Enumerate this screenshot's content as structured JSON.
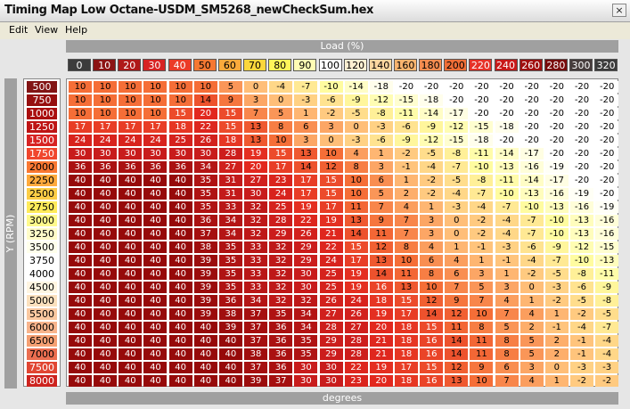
{
  "window": {
    "title": "Timing Map Low Octane-USDM_SM5268_newCheckSum.hex",
    "close_label": "×"
  },
  "menu": [
    "Edit",
    "View",
    "Help"
  ],
  "load_axis": {
    "title": "Load (%)",
    "values": [
      "0",
      "10",
      "20",
      "30",
      "40",
      "50",
      "60",
      "70",
      "80",
      "90",
      "100",
      "120",
      "140",
      "160",
      "180",
      "200",
      "220",
      "240",
      "260",
      "280",
      "300",
      "320"
    ]
  },
  "rpm_axis": {
    "title": "Y (RPM)",
    "values": [
      "500",
      "750",
      "1000",
      "1250",
      "1500",
      "1750",
      "2000",
      "2250",
      "2500",
      "2750",
      "3000",
      "3250",
      "3500",
      "3750",
      "4000",
      "4500",
      "5000",
      "5500",
      "6000",
      "6500",
      "7000",
      "7500",
      "8000"
    ]
  },
  "unit_label": "degrees",
  "table": [
    [
      10,
      10,
      10,
      10,
      10,
      10,
      5,
      0,
      -4,
      -7,
      -10,
      -14,
      -18,
      -20,
      -20,
      -20,
      -20,
      -20,
      -20,
      -20,
      -20,
      -20
    ],
    [
      10,
      10,
      10,
      10,
      10,
      14,
      9,
      3,
      0,
      -3,
      -6,
      -9,
      -12,
      -15,
      -18,
      -20,
      -20,
      -20,
      -20,
      -20,
      -20,
      -20
    ],
    [
      10,
      10,
      10,
      10,
      15,
      20,
      15,
      7,
      5,
      1,
      -2,
      -5,
      -8,
      -11,
      -14,
      -17,
      -20,
      -20,
      -20,
      -20,
      -20,
      -20
    ],
    [
      17,
      17,
      17,
      17,
      18,
      22,
      15,
      13,
      8,
      6,
      3,
      0,
      -3,
      -6,
      -9,
      -12,
      -15,
      -18,
      -20,
      -20,
      -20,
      -20
    ],
    [
      24,
      24,
      24,
      24,
      25,
      26,
      18,
      13,
      10,
      3,
      0,
      -3,
      -6,
      -9,
      -12,
      -15,
      -18,
      -20,
      -20,
      -20,
      -20,
      -20
    ],
    [
      30,
      30,
      30,
      30,
      30,
      30,
      28,
      19,
      15,
      13,
      10,
      4,
      1,
      -2,
      -5,
      -8,
      -11,
      -14,
      -17,
      -20,
      -20,
      -20
    ],
    [
      36,
      36,
      36,
      36,
      36,
      34,
      27,
      20,
      17,
      14,
      12,
      8,
      3,
      -1,
      -4,
      -7,
      -10,
      -13,
      -16,
      -19,
      -20,
      -20
    ],
    [
      40,
      40,
      40,
      40,
      40,
      35,
      31,
      27,
      23,
      17,
      15,
      10,
      6,
      1,
      -2,
      -5,
      -8,
      -11,
      -14,
      -17,
      -20,
      -20
    ],
    [
      40,
      40,
      40,
      40,
      40,
      35,
      31,
      30,
      24,
      17,
      15,
      10,
      5,
      2,
      -2,
      -4,
      -7,
      -10,
      -13,
      -16,
      -19,
      -20
    ],
    [
      40,
      40,
      40,
      40,
      40,
      35,
      33,
      32,
      25,
      19,
      17,
      11,
      7,
      4,
      1,
      -3,
      -4,
      -7,
      -10,
      -13,
      -16,
      -19
    ],
    [
      40,
      40,
      40,
      40,
      40,
      36,
      34,
      32,
      28,
      22,
      19,
      13,
      9,
      7,
      3,
      0,
      -2,
      -4,
      -7,
      -10,
      -13,
      -16
    ],
    [
      40,
      40,
      40,
      40,
      40,
      37,
      34,
      32,
      29,
      26,
      21,
      14,
      11,
      7,
      3,
      0,
      -2,
      -4,
      -7,
      -10,
      -13,
      -16
    ],
    [
      40,
      40,
      40,
      40,
      40,
      38,
      35,
      33,
      32,
      29,
      22,
      15,
      12,
      8,
      4,
      1,
      -1,
      -3,
      -6,
      -9,
      -12,
      -15
    ],
    [
      40,
      40,
      40,
      40,
      40,
      39,
      35,
      33,
      32,
      29,
      24,
      17,
      13,
      10,
      6,
      4,
      1,
      -1,
      -4,
      -7,
      -10,
      -13
    ],
    [
      40,
      40,
      40,
      40,
      40,
      39,
      35,
      33,
      32,
      30,
      25,
      19,
      14,
      11,
      8,
      6,
      3,
      1,
      -2,
      -5,
      -8,
      -11
    ],
    [
      40,
      40,
      40,
      40,
      40,
      39,
      35,
      33,
      32,
      30,
      25,
      19,
      16,
      13,
      10,
      7,
      5,
      3,
      0,
      -3,
      -6,
      -9
    ],
    [
      40,
      40,
      40,
      40,
      40,
      39,
      36,
      34,
      32,
      32,
      26,
      24,
      18,
      15,
      12,
      9,
      7,
      4,
      1,
      -2,
      -5,
      -8
    ],
    [
      40,
      40,
      40,
      40,
      40,
      39,
      38,
      37,
      35,
      34,
      27,
      26,
      19,
      17,
      14,
      12,
      10,
      7,
      4,
      1,
      -2,
      -5
    ],
    [
      40,
      40,
      40,
      40,
      40,
      40,
      39,
      37,
      36,
      34,
      28,
      27,
      20,
      18,
      15,
      11,
      8,
      5,
      2,
      -1,
      -4,
      -7
    ],
    [
      40,
      40,
      40,
      40,
      40,
      40,
      40,
      37,
      36,
      35,
      29,
      28,
      21,
      18,
      16,
      14,
      11,
      8,
      5,
      2,
      -1,
      -4
    ],
    [
      40,
      40,
      40,
      40,
      40,
      40,
      40,
      38,
      36,
      35,
      29,
      28,
      21,
      18,
      16,
      14,
      11,
      8,
      5,
      2,
      -1,
      -4
    ],
    [
      40,
      40,
      40,
      40,
      40,
      40,
      40,
      37,
      36,
      30,
      30,
      22,
      19,
      17,
      15,
      12,
      9,
      6,
      3,
      0,
      -3,
      -3
    ],
    [
      40,
      40,
      40,
      40,
      40,
      40,
      40,
      39,
      37,
      30,
      30,
      23,
      20,
      18,
      16,
      13,
      10,
      7,
      4,
      1,
      -2,
      -2
    ]
  ]
}
